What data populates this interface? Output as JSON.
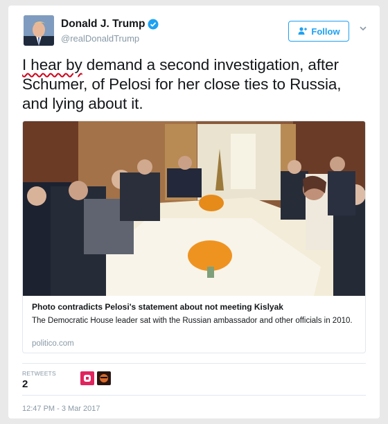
{
  "tweet": {
    "author": {
      "name": "Donald J. Trump",
      "handle": "@realDonaldTrump",
      "avatar_icon": "profile-photo-icon",
      "verified_icon": "verified-badge-icon"
    },
    "follow_label": "Follow",
    "text_misspelled": "I hear by",
    "text_rest": " demand a second investigation, after Schumer, of Pelosi for her close ties to Russia, and lying about it.",
    "card": {
      "title": "Photo contradicts Pelosi's statement about not meeting Kislyak",
      "description": "The Democratic House leader sat with the Russian ambassador and other officials in 2010.",
      "domain": "politico.com"
    },
    "retweets_label": "RETWEETS",
    "retweets_count": "2",
    "timestamp": "12:47 PM - 3 Mar 2017"
  },
  "colors": {
    "accent": "#1da1f2",
    "spellcheck_underline": "#d0021b",
    "muted_text": "#8899a6"
  }
}
